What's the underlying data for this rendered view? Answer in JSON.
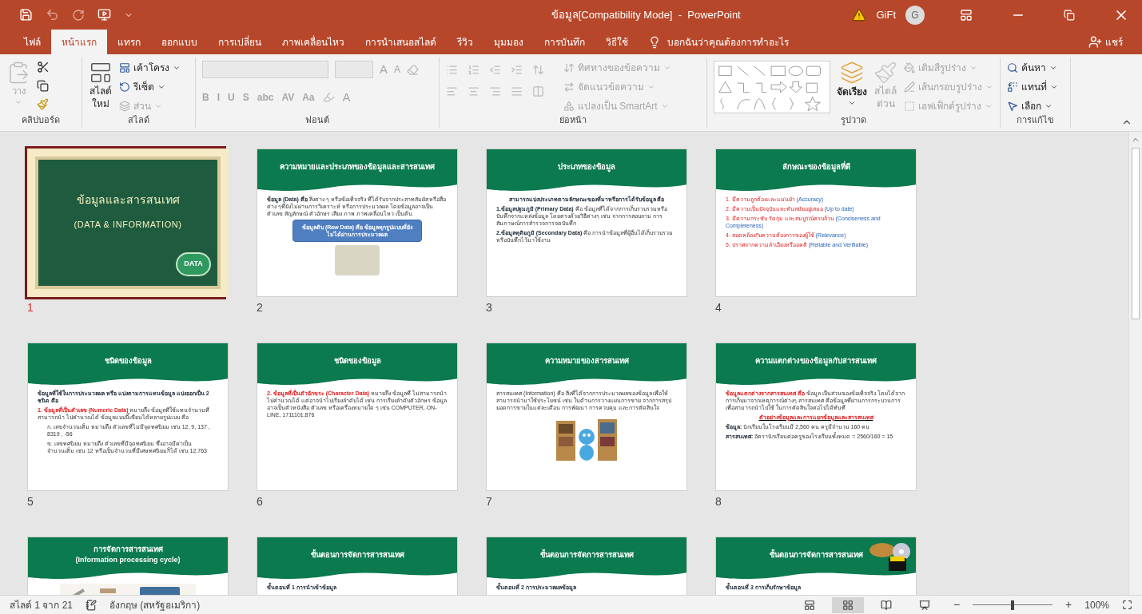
{
  "title_bar": {
    "title": "ข้อมูล[Compatibility Mode]  -  PowerPoint",
    "user": "GiFt",
    "avatar_initial": "G"
  },
  "tabs": [
    {
      "label": "ไฟล์",
      "selected": false
    },
    {
      "label": "หน้าแรก",
      "selected": true
    },
    {
      "label": "แทรก",
      "selected": false
    },
    {
      "label": "ออกแบบ",
      "selected": false
    },
    {
      "label": "การเปลี่ยน",
      "selected": false
    },
    {
      "label": "ภาพเคลื่อนไหว",
      "selected": false
    },
    {
      "label": "การนำเสนอสไลด์",
      "selected": false
    },
    {
      "label": "รีวิว",
      "selected": false
    },
    {
      "label": "มุมมอง",
      "selected": false
    },
    {
      "label": "การบันทึก",
      "selected": false
    },
    {
      "label": "วิธีใช้",
      "selected": false
    }
  ],
  "tell_me": {
    "placeholder": "บอกฉันว่าคุณต้องการทำอะไร"
  },
  "share": "แชร์",
  "ribbon": {
    "clipboard": {
      "label": "คลิปบอร์ด",
      "paste": {
        "label": "วาง",
        "disabled": true
      }
    },
    "slides": {
      "label": "สไลด์",
      "new_slide": [
        "สไลด์",
        "ใหม่"
      ],
      "commands": [
        {
          "label": "เค้าโครง",
          "disabled": false
        },
        {
          "label": "รีเซ็ต",
          "disabled": false
        },
        {
          "label": "ส่วน",
          "disabled": true
        }
      ]
    },
    "font": {
      "label": "ฟอนต์",
      "grow": "A",
      "shrink": "A",
      "buttons": [
        "B",
        "I",
        "U",
        "S",
        "abc",
        "AV",
        "Aa"
      ],
      "color_button": "A"
    },
    "paragraph": {
      "label": "ย่อหน้า",
      "commands": [
        {
          "label": "ทิศทางของข้อความ",
          "disabled": true
        },
        {
          "label": "จัดแนวข้อความ",
          "disabled": true
        },
        {
          "label": "แปลงเป็น SmartArt",
          "disabled": true
        }
      ]
    },
    "drawing": {
      "label": "รูปวาด",
      "arrange": {
        "label": "จัดเรียง",
        "disabled": false
      },
      "quick_styles": {
        "label": [
          "สไตล์",
          "ด่วน"
        ],
        "disabled": true
      },
      "commands": [
        {
          "label": "เติมสีรูปร่าง",
          "disabled": true
        },
        {
          "label": "เส้นกรอบรูปร่าง",
          "disabled": true
        },
        {
          "label": "เอฟเฟ็กต์รูปร่าง",
          "disabled": true
        }
      ]
    },
    "editing": {
      "label": "การแก้ไข",
      "commands": [
        {
          "label": "ค้นหา",
          "disabled": false
        },
        {
          "label": "แทนที่",
          "disabled": false
        },
        {
          "label": "เลือก",
          "disabled": false
        }
      ]
    }
  },
  "slides": [
    {
      "number": "1",
      "selected": true,
      "kind": "chalkboard",
      "title": "ข้อมูลและสารสนเทศ",
      "subtitle": "(DATA & INFORMATION)",
      "badge": "DATA"
    },
    {
      "number": "2",
      "selected": false,
      "kind": "content",
      "title": "ความหมายและประเภทของข้อมูลและสารสนเทศ",
      "body": [
        {
          "kind": "text",
          "segments": [
            {
              "text": "ข้อมูล (Data) คือ",
              "kind": "term"
            },
            {
              "text": " สิ่งต่าง ๆ หรือข้อเท็จจริง ที่ได้รับจากประสาทสัมผัส หรือสื่อต่าง ๆที่ยังไม่ผ่านการวิเคราะห์ หรือการประมวลผล โดยข้อมูลอาจเป็นตัวเลข สัญลักษณ์ ตัวอักษร เสียง ภาพ ภาพเคลื่อนไหว เป็นต้น",
              "kind": "plain"
            }
          ]
        },
        {
          "kind": "callout",
          "segments": [
            {
              "text": "ข้อมูลดิบ (Raw Data) คือ ข้อมูลทุกรูปแบบที่ยังไม่ได้ผ่านการประมวลผล",
              "kind": "inverse"
            }
          ]
        }
      ],
      "picture": {
        "kind": "photo"
      }
    },
    {
      "number": "3",
      "selected": false,
      "kind": "content",
      "title": "ประเภทของข้อมูล",
      "body": [
        {
          "kind": "centered",
          "segments": [
            {
              "text": "สามารถแบ่งประเภทตามลักษณะของที่มาหรือการได้รับข้อมูล คือ",
              "kind": "term"
            }
          ]
        },
        {
          "kind": "text",
          "segments": [
            {
              "text": "1.ข้อมูลปฐมภูมิ (Primary Data)",
              "kind": "term"
            },
            {
              "text": " คือ ข้อมูลที่ได้จากการเก็บรวบรวมหรือบันทึกจากแหล่งข้อมูล โดยตรงด้วยวิธีต่างๆ เช่น จากการสอบถาม การสัมภาษณ์การสำรวจการจดบันทึก",
              "kind": "plain"
            }
          ]
        },
        {
          "kind": "text",
          "segments": [
            {
              "text": "2.ข้อมูลทุติยภูมิ (Secondary Data)",
              "kind": "term"
            },
            {
              "text": " คือ การนำข้อมูลที่ผู้อื่นได้เก็บรวบรวมหรือบันทึกไว้มาใช้งาน",
              "kind": "plain"
            }
          ]
        }
      ]
    },
    {
      "number": "4",
      "selected": false,
      "kind": "content",
      "title": "ลักษณะของข้อมูลที่ดี",
      "body": [
        {
          "kind": "item",
          "segments": [
            {
              "text": "1. มีความถูกต้องและแม่นยำ",
              "kind": "point"
            },
            {
              "text": "  (Accuracy)",
              "kind": "english"
            }
          ]
        },
        {
          "kind": "item",
          "segments": [
            {
              "text": "2. มีความเป็นปัจจุบันและทันสมัยอยู่เสมอ",
              "kind": "point"
            },
            {
              "text": "  (Up to date)",
              "kind": "english"
            }
          ]
        },
        {
          "kind": "item",
          "segments": [
            {
              "text": "3. มีความกระชับ รัดกุม และสมบูรณ์ครบถ้วน",
              "kind": "point"
            },
            {
              "text": " (Conciseness and Completeness)",
              "kind": "english"
            }
          ]
        },
        {
          "kind": "item",
          "segments": [
            {
              "text": "4. สอดคล้องกับความต้องการของผู้ใช้",
              "kind": "point"
            },
            {
              "text": " (Relevance)",
              "kind": "english"
            }
          ]
        },
        {
          "kind": "item",
          "segments": [
            {
              "text": "5. ปราศจากความลำเอียงหรืออคติ",
              "kind": "point"
            },
            {
              "text": " (Reliable and Verifiable)",
              "kind": "english"
            }
          ]
        }
      ]
    },
    {
      "number": "5",
      "selected": false,
      "kind": "content",
      "title": "ชนิดของข้อมูล",
      "body": [
        {
          "kind": "text",
          "segments": [
            {
              "text": "ข้อมูลที่ใช้ในการประมวลผล หรือ แบ่งตามการแทนข้อมูล แบ่งออกเป็น 2 ชนิด คือ",
              "kind": "term"
            }
          ]
        },
        {
          "kind": "text",
          "segments": [
            {
              "text": "1. ข้อมูลที่เป็นตัวเลข (Numeric Data)",
              "kind": "emphasis"
            },
            {
              "text": " หมายถึง ข้อมูลที่ใช้แทนจำนวนที่สามารถนำ ไปคำนวณได้ ข้อมูลแบบนี้เขียนได้หลายรูปแบบ คือ",
              "kind": "plain"
            }
          ]
        },
        {
          "kind": "indent",
          "segments": [
            {
              "text": "ก. เลขจำนวนเต็ม หมายถึง ตัวเลขที่ไม่มีจุดทศนิยม เช่น 12, 9, 137 , 8319 , -56",
              "kind": "plain"
            }
          ]
        },
        {
          "kind": "indent",
          "segments": [
            {
              "text": "ข. เลขทศนิยม หมายถึง ตัวเลขที่มีจุดทศนิยม ซึ่งอาจมีค่าเป็นจำนวนเต็ม เช่น 12 หรือเป็นจำนวนที่มีเศษทศนิยมก็ได้ เช่น 12.763",
              "kind": "plain"
            }
          ]
        }
      ]
    },
    {
      "number": "6",
      "selected": false,
      "kind": "content",
      "title": "ชนิดของข้อมูล",
      "body": [
        {
          "kind": "text",
          "segments": [
            {
              "text": "2. ข้อมูลที่เป็นตัวอักขระ (Character Data)",
              "kind": "emphasis"
            },
            {
              "text": " หมายถึง ข้อมูลที่ ไม่สามารถนำ ไปคำนวณได้ แต่อาจนำไปเรียงลำดับได้ เช่น การเรียงลำดับตัวอักษร ข้อมูลอาจเป็นตัวหนังสือ ตัวเลข หรือเครื่องหมายใด ๆ เช่น COMPUTER, ON-LINE, 1711101,876",
              "kind": "plain"
            }
          ]
        }
      ]
    },
    {
      "number": "7",
      "selected": false,
      "kind": "content",
      "title": "ความหมายของสารสนเทศ",
      "body": [
        {
          "kind": "text",
          "segments": [
            {
              "text": "สารสนเทศ (Information) คือ สิ่งที่ได้จากการประมวลผลของข้อมูล เพื่อให้สามารถนำมาใช้ประโยชน์ เช่น ในด้านการวางแผนการขาย จากการสรุปยอดการขายในแต่ละเดือน การพัฒนา การควบคุม และการตัดสินใจ",
              "kind": "plain"
            }
          ]
        }
      ],
      "picture": {
        "kind": "cartoon"
      }
    },
    {
      "number": "8",
      "selected": false,
      "kind": "content",
      "title": "ความแตกต่างของข้อมูลกับสารสนเทศ",
      "body": [
        {
          "kind": "text",
          "segments": [
            {
              "text": "ข้อมูลแตกต่างจากสารสนเทศ คือ",
              "kind": "emphasis"
            },
            {
              "text": " ข้อมูล เป็นส่วนของข้อเท็จจริง โดยได้จากการเก็บมาจากเหตุการณ์ต่างๆ สารสนเทศ คือข้อมูลที่ผ่านการกระบวนการเพื่อสามารถนำไปใช้ ในการตัดสินใจต่อไปได้ทันที",
              "kind": "plain"
            }
          ]
        },
        {
          "kind": "underlined",
          "segments": [
            {
              "text": "ตัวอย่างข้อมูลและการแยกข้อมูลและสารสนเทศ",
              "kind": "emphasis"
            }
          ]
        },
        {
          "kind": "text",
          "segments": [
            {
              "text": "ข้อมูล:",
              "kind": "term"
            },
            {
              "text": " นักเรียนในโรงเรียนมี 2,560 คน ครูมีจำนวน 160 คน",
              "kind": "plain"
            }
          ]
        },
        {
          "kind": "text",
          "segments": [
            {
              "text": "สารสนเทศ:",
              "kind": "term"
            },
            {
              "text": " อัตรานักเรียนต่อครูของโรงเรียนทั้งหมด = 2560/160 = 15",
              "kind": "plain"
            }
          ]
        }
      ]
    },
    {
      "selected": false,
      "kind": "content",
      "title": "การจัดการสารสนเทศ",
      "subtitle": "(Information processing cycle)",
      "picture": {
        "kind": "diagram"
      }
    },
    {
      "selected": false,
      "kind": "content",
      "title": "ขั้นตอนการจัดการสารสนเทศ",
      "body": [
        {
          "kind": "step",
          "segments": [
            {
              "text": "ขั้นตอนที่ 1    การนำเข้าข้อมูล",
              "kind": "term"
            }
          ]
        }
      ]
    },
    {
      "selected": false,
      "kind": "content",
      "title": "ขั้นตอนการจัดการสารสนเทศ",
      "body": [
        {
          "kind": "step",
          "segments": [
            {
              "text": "ขั้นตอนที่ 2    การประมวลผลข้อมูล",
              "kind": "term"
            }
          ]
        }
      ]
    },
    {
      "selected": false,
      "kind": "content",
      "title": "ขั้นตอนการจัดการสารสนเทศ",
      "body": [
        {
          "kind": "step",
          "segments": [
            {
              "text": "ขั้นตอนที่ 3 การเก็บรักษาข้อมูล",
              "kind": "term"
            }
          ]
        }
      ],
      "picture": {
        "kind": "disc"
      }
    }
  ],
  "status_bar": {
    "slide_counter": "สไลด์ 1 จาก 21",
    "language": "อังกฤษ (สหรัฐอเมริกา)",
    "views": [
      {
        "kind": "normal",
        "selected": false
      },
      {
        "kind": "sorter",
        "selected": true
      },
      {
        "kind": "reading",
        "selected": false
      },
      {
        "kind": "slideshow",
        "selected": false
      }
    ],
    "zoom_out": "−",
    "zoom_in": "+",
    "zoom": {
      "level": 0.5,
      "reading": "100%"
    }
  }
}
